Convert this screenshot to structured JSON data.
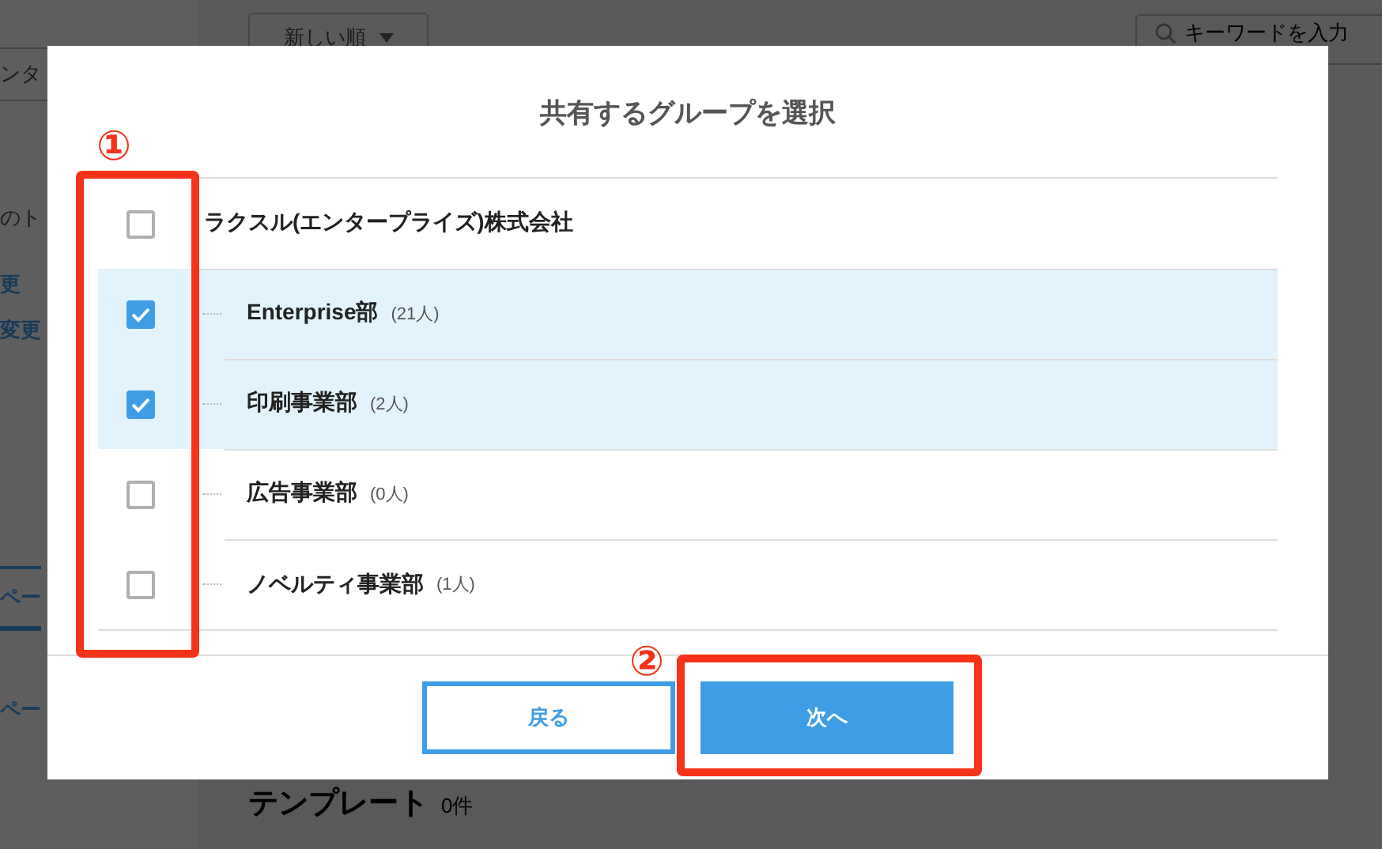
{
  "background": {
    "sidebar_items": [
      {
        "text": "ンタ",
        "kind": "boxed"
      },
      {
        "text": "のト",
        "kind": "plain"
      },
      {
        "text": "更",
        "kind": "link"
      },
      {
        "text": "変更",
        "kind": "link"
      },
      {
        "text": "ペー",
        "kind": "tab"
      },
      {
        "text": "ペー",
        "kind": "link"
      }
    ],
    "sort_dropdown": {
      "label": "新しい順"
    },
    "search": {
      "placeholder": "キーワードを入力"
    },
    "section": {
      "title": "テンプレート",
      "count": "0件"
    }
  },
  "dialog": {
    "title": "共有するグループを選択",
    "organization": {
      "name": "ラクスル(エンタープライズ)株式会社",
      "checked": false,
      "children": [
        {
          "name": "Enterprise部",
          "count": "(21人)",
          "checked": true
        },
        {
          "name": "印刷事業部",
          "count": "(2人)",
          "checked": true
        },
        {
          "name": "広告事業部",
          "count": "(0人)",
          "checked": false
        },
        {
          "name": "ノベルティ事業部",
          "count": "(1人)",
          "checked": false
        }
      ]
    },
    "buttons": [
      {
        "label": "戻る",
        "kind": "secondary"
      },
      {
        "label": "次へ",
        "kind": "primary"
      }
    ]
  },
  "annotations": [
    {
      "label": "①",
      "kind": "checkboxes"
    },
    {
      "label": "②",
      "kind": "next"
    }
  ]
}
